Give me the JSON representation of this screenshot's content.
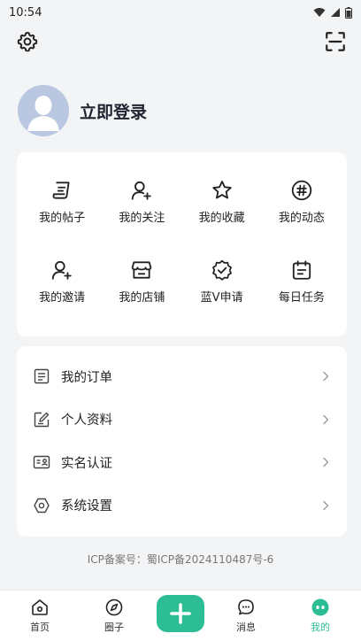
{
  "status_bar": {
    "time": "10:54"
  },
  "profile": {
    "login_label": "立即登录"
  },
  "grid": {
    "items": [
      {
        "label": "我的帖子",
        "icon": "post-icon"
      },
      {
        "label": "我的关注",
        "icon": "user-add-icon"
      },
      {
        "label": "我的收藏",
        "icon": "star-icon"
      },
      {
        "label": "我的动态",
        "icon": "hashtag-icon"
      },
      {
        "label": "我的邀请",
        "icon": "user-plus-icon"
      },
      {
        "label": "我的店铺",
        "icon": "store-icon"
      },
      {
        "label": "蓝V申请",
        "icon": "verified-badge-icon"
      },
      {
        "label": "每日任务",
        "icon": "calendar-icon"
      }
    ]
  },
  "list": {
    "items": [
      {
        "label": "我的订单",
        "icon": "order-icon"
      },
      {
        "label": "个人资料",
        "icon": "edit-document-icon"
      },
      {
        "label": "实名认证",
        "icon": "id-card-icon"
      },
      {
        "label": "系统设置",
        "icon": "hex-settings-icon"
      }
    ]
  },
  "icp": "ICP备案号：蜀ICP备2024110487号-6",
  "tabs": [
    {
      "label": "首页",
      "icon": "home-icon"
    },
    {
      "label": "圈子",
      "icon": "compass-icon"
    },
    {
      "label": "消息",
      "icon": "chat-icon"
    },
    {
      "label": "我的",
      "icon": "face-icon"
    }
  ],
  "colors": {
    "accent": "#2dbd95",
    "background": "#f3f4f6",
    "card": "#ffffff"
  }
}
